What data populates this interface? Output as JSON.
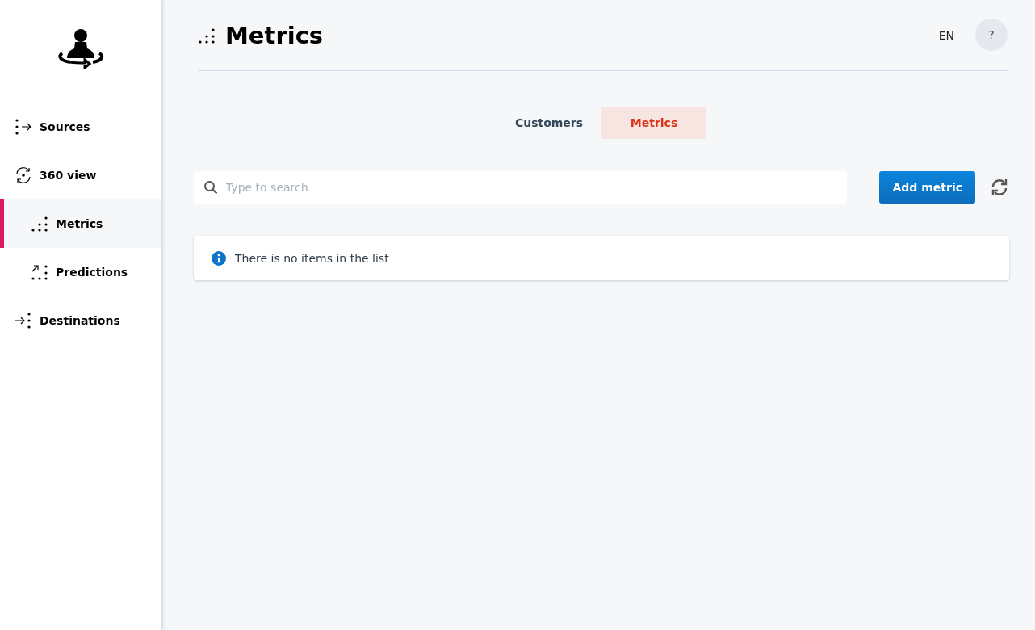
{
  "sidebar": {
    "items": [
      {
        "label": "Sources",
        "kind": "sources",
        "selected": false
      },
      {
        "label": "360 view",
        "kind": "view",
        "selected": false,
        "children": [
          {
            "label": "Metrics",
            "kind": "metrics",
            "selected": true
          },
          {
            "label": "Predictions",
            "kind": "predictions",
            "selected": false
          }
        ]
      },
      {
        "label": "Destinations",
        "kind": "destinations",
        "selected": false
      }
    ]
  },
  "header": {
    "title": "Metrics",
    "language": "EN",
    "help": "?"
  },
  "tabs": [
    {
      "label": "Customers",
      "selected": false
    },
    {
      "label": "Metrics",
      "selected": true
    }
  ],
  "search": {
    "placeholder": "Type to search"
  },
  "add_button": "Add metric",
  "notice": "There is no items in the list"
}
